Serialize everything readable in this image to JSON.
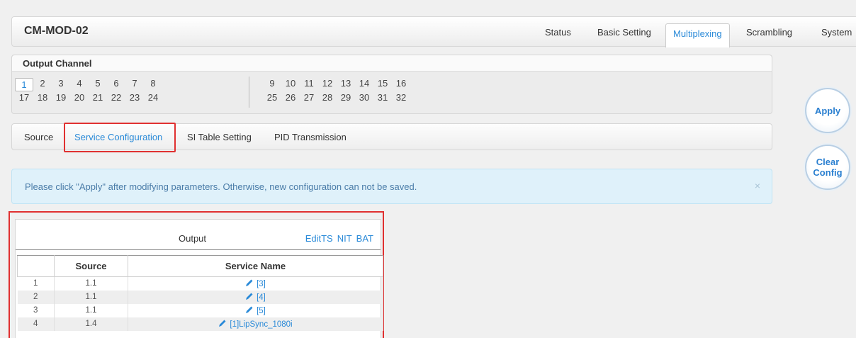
{
  "header": {
    "device_title": "CM-MOD-02",
    "nav": [
      "Status",
      "Basic Setting",
      "Multiplexing",
      "Scrambling",
      "System"
    ],
    "active_nav": "Multiplexing"
  },
  "channels": {
    "title": "Output Channel",
    "row1": [
      "1",
      "2",
      "3",
      "4",
      "5",
      "6",
      "7",
      "8",
      "9",
      "10",
      "11",
      "12",
      "13",
      "14",
      "15",
      "16"
    ],
    "row2": [
      "17",
      "18",
      "19",
      "20",
      "21",
      "22",
      "23",
      "24",
      "25",
      "26",
      "27",
      "28",
      "29",
      "30",
      "31",
      "32"
    ],
    "active": "1"
  },
  "subtabs": {
    "items": [
      "Source",
      "Service Configuration",
      "SI Table Setting",
      "PID Transmission"
    ],
    "active": "Service Configuration"
  },
  "buttons": {
    "apply": "Apply",
    "clear_line1": "Clear",
    "clear_line2": "Config"
  },
  "alert": {
    "message": "Please click \"Apply\" after modifying parameters. Otherwise, new configuration can not be saved.",
    "close": "×"
  },
  "output": {
    "title": "Output",
    "links": [
      "EditTS",
      "NIT",
      "BAT"
    ],
    "columns": [
      "",
      "Source",
      "Service Name"
    ],
    "rows": [
      {
        "index": "1",
        "source": "1.1",
        "service": "[3]"
      },
      {
        "index": "2",
        "source": "1.1",
        "service": "[4]"
      },
      {
        "index": "3",
        "source": "1.1",
        "service": "[5]"
      },
      {
        "index": "4",
        "source": "1.4",
        "service": "[1]LipSync_1080i"
      }
    ]
  },
  "icons": {
    "edit": "pencil-icon",
    "close": "close-icon"
  },
  "colors": {
    "accent": "#2a8ad8",
    "highlight_border": "#e03030",
    "alert_bg": "#dff1fa"
  }
}
